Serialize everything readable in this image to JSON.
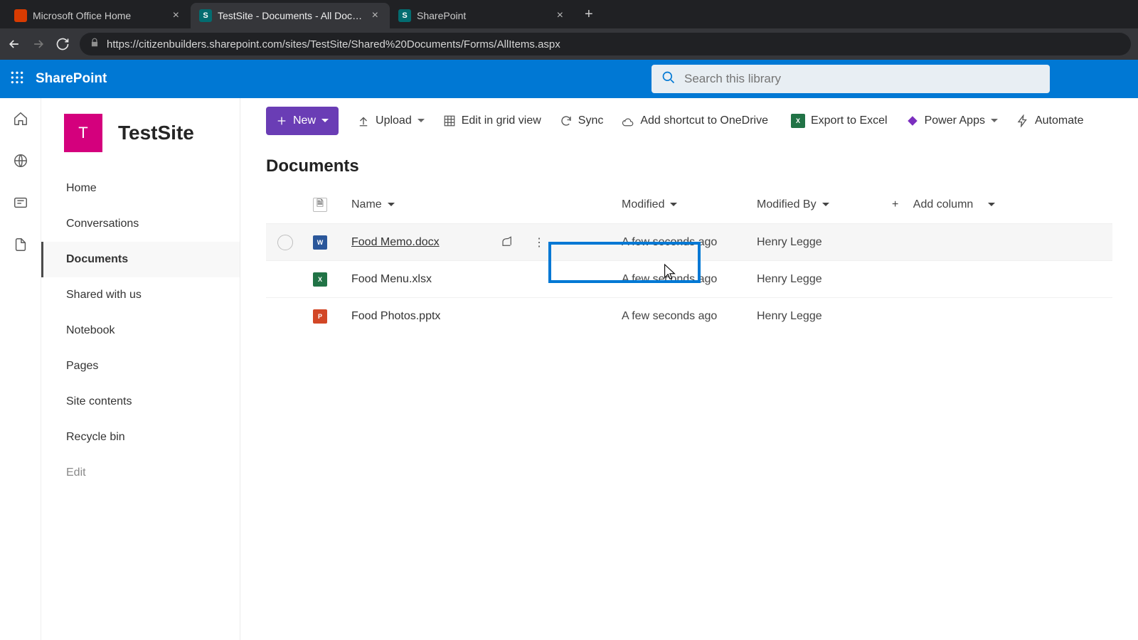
{
  "browser": {
    "tabs": [
      {
        "label": "Microsoft Office Home",
        "favBg": "#d83b01",
        "favTxt": "",
        "active": false
      },
      {
        "label": "TestSite - Documents - All Docum",
        "favBg": "#036c70",
        "favTxt": "S",
        "active": true
      },
      {
        "label": "SharePoint",
        "favBg": "#036c70",
        "favTxt": "S",
        "active": false
      }
    ],
    "url_full": "https://citizenbuilders.sharepoint.com/sites/TestSite/Shared%20Documents/Forms/AllItems.aspx"
  },
  "brand": "SharePoint",
  "search": {
    "placeholder": "Search this library"
  },
  "site": {
    "logoLetter": "T",
    "title": "TestSite"
  },
  "leftnav": [
    {
      "label": "Home",
      "active": false
    },
    {
      "label": "Conversations",
      "active": false
    },
    {
      "label": "Documents",
      "active": true
    },
    {
      "label": "Shared with us",
      "active": false
    },
    {
      "label": "Notebook",
      "active": false
    },
    {
      "label": "Pages",
      "active": false
    },
    {
      "label": "Site contents",
      "active": false
    },
    {
      "label": "Recycle bin",
      "active": false
    },
    {
      "label": "Edit",
      "muted": true
    }
  ],
  "toolbar": {
    "new": "New",
    "upload": "Upload",
    "editGrid": "Edit in grid view",
    "sync": "Sync",
    "addShortcut": "Add shortcut to OneDrive",
    "exportExcel": "Export to Excel",
    "powerApps": "Power Apps",
    "automate": "Automate"
  },
  "list": {
    "title": "Documents",
    "columns": {
      "name": "Name",
      "modified": "Modified",
      "modifiedBy": "Modified By",
      "addColumn": "Add column"
    },
    "rows": [
      {
        "icon": "word",
        "iconTxt": "W",
        "name": "Food Memo.docx",
        "modified": "A few seconds ago",
        "modifiedBy": "Henry Legge",
        "hovered": true
      },
      {
        "icon": "excel",
        "iconTxt": "X",
        "name": "Food Menu.xlsx",
        "modified": "A few seconds ago",
        "modifiedBy": "Henry Legge",
        "hovered": false
      },
      {
        "icon": "ppt",
        "iconTxt": "P",
        "name": "Food Photos.pptx",
        "modified": "A few seconds ago",
        "modifiedBy": "Henry Legge",
        "hovered": false
      }
    ]
  }
}
